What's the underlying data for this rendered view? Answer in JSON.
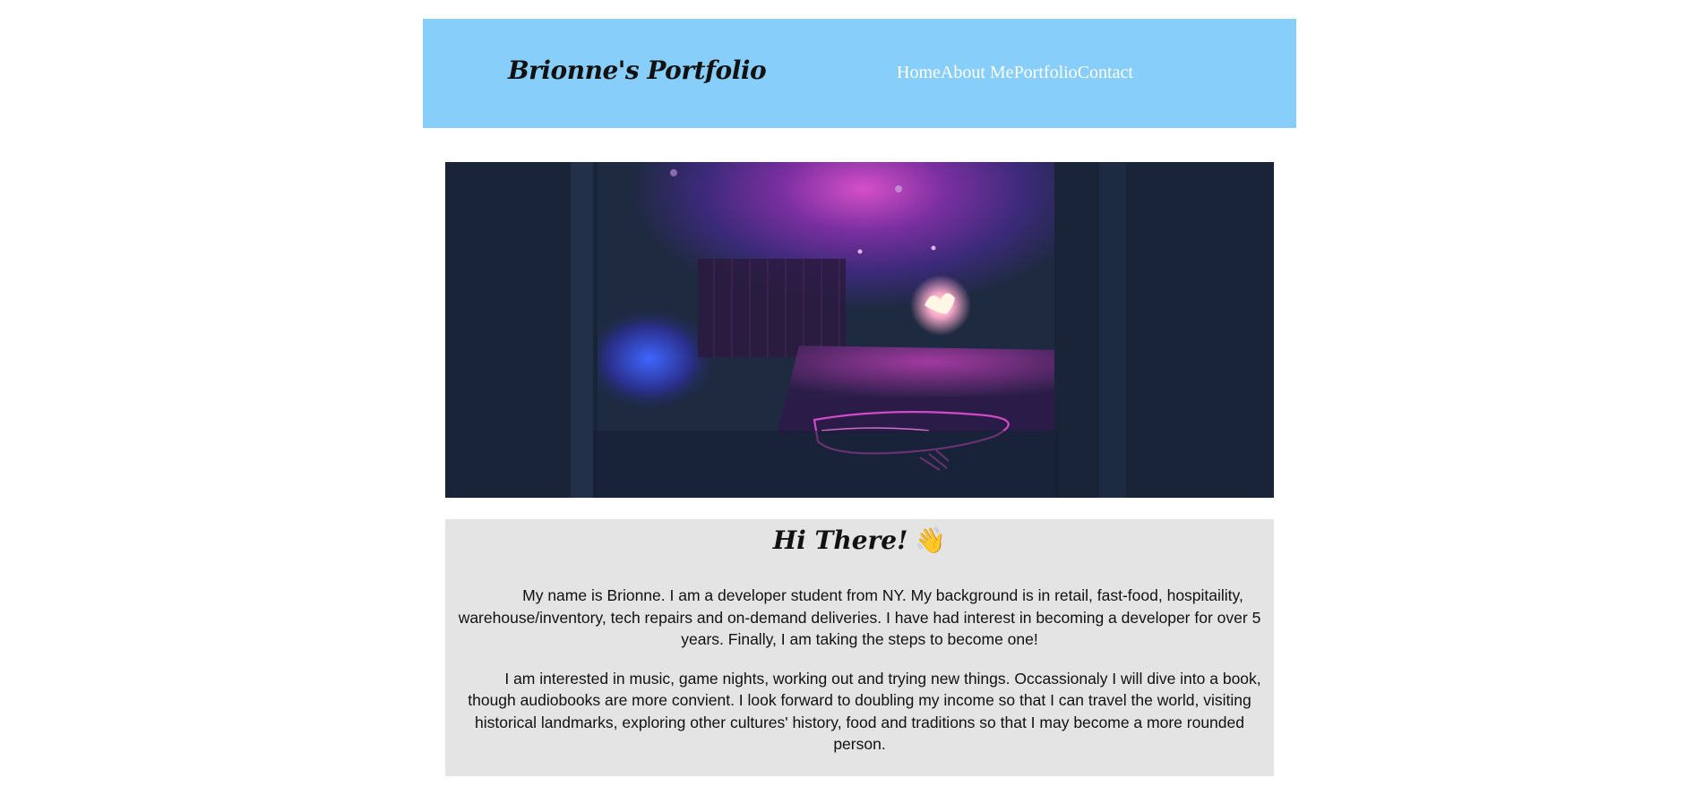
{
  "header": {
    "brand": "Brionne's Portfolio",
    "nav": [
      "Home",
      "About Me",
      "Portfolio",
      "Contact"
    ]
  },
  "hero": {
    "image_icon": "neon-bedroom-photo"
  },
  "intro": {
    "title": "Hi There!",
    "title_icon": "👋",
    "paragraphs": [
      "My name is Brionne. I am a developer student from NY. My background is in retail, fast-food, hospitaility, warehouse/inventory, tech repairs and on-demand deliveries. I have had interest in becoming a developer for over 5 years. Finally, I am taking the steps to become one!",
      "I am interested in music, game nights, working out and trying new things. Occassionaly I will dive into a book, though audiobooks are more convient. I look forward to doubling my income so that I can travel the world, visiting historical landmarks, exploring other cultures' history, food and traditions so that I may become a more rounded person."
    ]
  },
  "colors": {
    "header_bg": "#87cefa",
    "intro_bg": "#e4e4e4",
    "neon_pink": "#e54fd4",
    "neon_blue": "#3b5cff"
  }
}
